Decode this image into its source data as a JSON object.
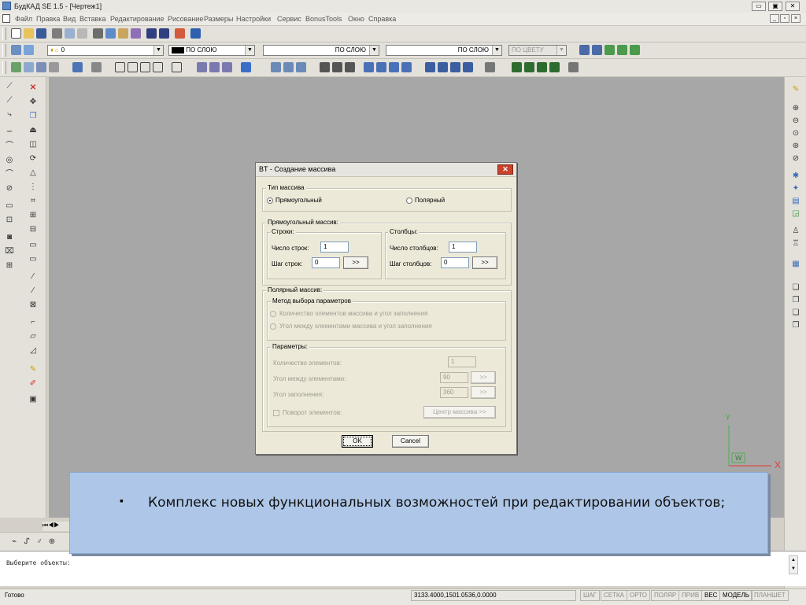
{
  "window": {
    "title": "БудКАД  SE 1.5 - [Чертеж1]"
  },
  "menu": [
    "Файл",
    "Правка",
    "Вид",
    "Вставка",
    "Редактирование",
    "Рисование",
    "Размеры",
    "Настройки",
    "Сервис",
    "BonusTools",
    "Окно",
    "Справка"
  ],
  "layer_toolbar": {
    "layer": "0",
    "color": "ПО СЛОЮ",
    "linetype": "ПО СЛОЮ",
    "lineweight": "ПО СЛОЮ",
    "plotstyle": "ПО ЦВЕТУ"
  },
  "dialog": {
    "title": "BT - Создание массива",
    "array_type": {
      "label": "Тип массива",
      "rectangular": "Прямоугольный",
      "polar": "Полярный",
      "selected": "rectangular"
    },
    "rect": {
      "label": "Прямоугольный массив:",
      "rows_group": "Строки:",
      "cols_group": "Столбцы:",
      "rows_count_label": "Число строк:",
      "rows_count": "1",
      "row_step_label": "Шаг строк:",
      "row_step": "0",
      "cols_count_label": "Число столбцов:",
      "cols_count": "1",
      "col_step_label": "Шаг столбцов:",
      "col_step": "0",
      "pick_label": ">>"
    },
    "polar": {
      "label": "Полярный массив:",
      "method_label": "Метод выбора параметров",
      "method_1": "Количество элементов массива и угол заполнения",
      "method_2": "Угол между элементами массива и угол заполнения",
      "params_label": "Параметры:",
      "count_label": "Количество элементов:",
      "count": "1",
      "angle_between_label": "Угол между элементами:",
      "angle_between": "90",
      "fill_angle_label": "Угол заполнения:",
      "fill_angle": "360",
      "rotate_label": "Поворот элементов:",
      "center_button": "Центр массива >>"
    },
    "ok": "OK",
    "cancel": "Cancel"
  },
  "banner": {
    "bullet": "▪",
    "text": "Комплекс новых функциональных возможностей при редактировании объектов;"
  },
  "ucs": {
    "x": "X",
    "y": "Y",
    "w": "W"
  },
  "command_line": {
    "prompt": "Выберите объекты:"
  },
  "status": {
    "ready": "Готово",
    "coords": "3133.4000,1501.0536,0.0000",
    "modes": [
      "ШАГ",
      "СЕТКА",
      "ОРТО",
      "ПОЛЯР",
      "ПРИВ",
      "ВЕС",
      "МОДЕЛЬ",
      "ПЛАНШЕТ"
    ],
    "active_modes": [
      "ВЕС",
      "МОДЕЛЬ"
    ]
  }
}
